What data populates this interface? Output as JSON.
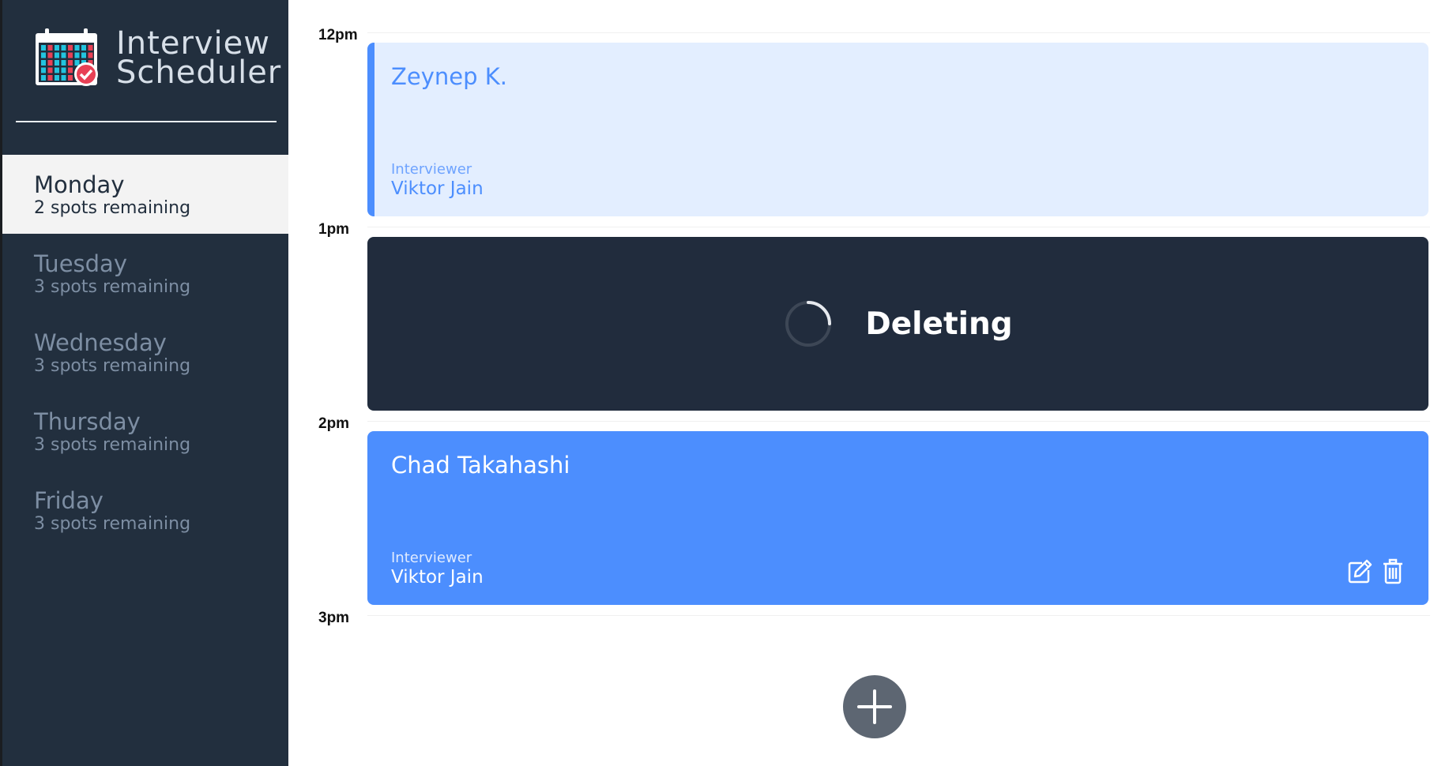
{
  "app": {
    "title_line1": "Interview",
    "title_line2": "Scheduler",
    "logo_icon": "calendar-check-icon"
  },
  "sidebar": {
    "days": [
      {
        "name": "Monday",
        "spots": "2 spots remaining",
        "selected": true
      },
      {
        "name": "Tuesday",
        "spots": "3 spots remaining",
        "selected": false
      },
      {
        "name": "Wednesday",
        "spots": "3 spots remaining",
        "selected": false
      },
      {
        "name": "Thursday",
        "spots": "3 spots remaining",
        "selected": false
      },
      {
        "name": "Friday",
        "spots": "3 spots remaining",
        "selected": false
      }
    ]
  },
  "schedule": {
    "times": [
      "12pm",
      "1pm",
      "2pm",
      "3pm"
    ],
    "appointments": [
      {
        "state": "booked-light",
        "student": "Zeynep K.",
        "interviewer_label": "Interviewer",
        "interviewer": "Viktor Jain"
      },
      {
        "state": "deleting",
        "status_text": "Deleting"
      },
      {
        "state": "booked",
        "student": "Chad Takahashi",
        "interviewer_label": "Interviewer",
        "interviewer": "Viktor Jain",
        "actions": [
          "edit-icon",
          "trash-icon"
        ]
      }
    ],
    "add_button_icon": "plus-icon"
  },
  "colors": {
    "sidebar_bg": "#222f3e",
    "accent": "#4c8efe",
    "light_accent_bg": "#e3eeff",
    "dark_card": "#212c3d",
    "add_button": "#5d6672"
  }
}
